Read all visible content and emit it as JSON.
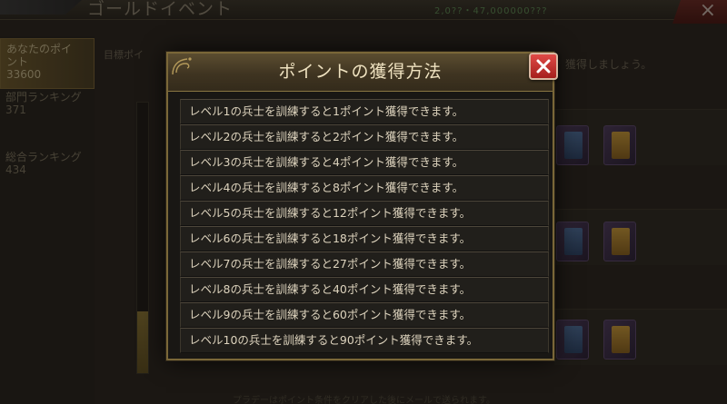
{
  "background": {
    "screen_title": "ゴールドイベント",
    "currency_text": "2,0??・47,000000???",
    "close_glyph": "×",
    "sidebar": {
      "active_label": "あなたのポイント",
      "active_value": "33600",
      "items": [
        {
          "label": "部門ランキング",
          "value": "371"
        },
        {
          "label": "総合ランキング",
          "value": "434"
        }
      ]
    },
    "hint_left": "目標ポイ",
    "hint_right": "獲得しましょう。",
    "footer_text": "プラデーはポイント条件をクリアした後にメールで送られます。"
  },
  "modal": {
    "title": "ポイントの獲得方法",
    "close_label": "×",
    "rows": [
      "レベル1の兵士を訓練すると1ポイント獲得できます。",
      "レベル2の兵士を訓練すると2ポイント獲得できます。",
      "レベル3の兵士を訓練すると4ポイント獲得できます。",
      "レベル4の兵士を訓練すると8ポイント獲得できます。",
      "レベル5の兵士を訓練すると12ポイント獲得できます。",
      "レベル6の兵士を訓練すると18ポイント獲得できます。",
      "レベル7の兵士を訓練すると27ポイント獲得できます。",
      "レベル8の兵士を訓練すると40ポイント獲得できます。",
      "レベル9の兵士を訓練すると60ポイント獲得できます。",
      "レベル10の兵士を訓練すると90ポイント獲得できます。"
    ]
  },
  "colors": {
    "modal_border": "#7a6738",
    "close_button": "#c23431",
    "row_text": "#ddd3bd",
    "title_text": "#efe2c0"
  }
}
